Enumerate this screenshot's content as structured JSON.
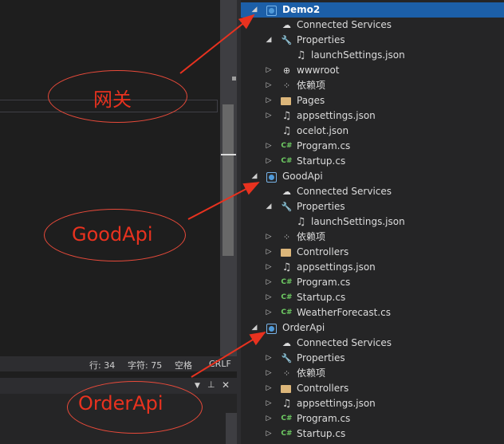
{
  "status_bar": {
    "line": "行: 34",
    "char": "字符: 75",
    "space": "空格",
    "crlf": "CRLF"
  },
  "panel": {
    "dropdown_icon": "▼",
    "pin_icon": "📌",
    "close_icon": "✕"
  },
  "explorer": {
    "rows": [
      {
        "label": "Demo2",
        "expander": "◢",
        "icon": "project-icon"
      },
      {
        "label": "Connected Services",
        "expander": "",
        "icon": "cloud-icon"
      },
      {
        "label": "Properties",
        "expander": "◢",
        "icon": "wrench-icon"
      },
      {
        "label": "launchSettings.json",
        "expander": "",
        "icon": "json-icon"
      },
      {
        "label": "wwwroot",
        "expander": "▷",
        "icon": "globe-icon"
      },
      {
        "label": "依赖项",
        "expander": "▷",
        "icon": "dependencies-icon"
      },
      {
        "label": "Pages",
        "expander": "▷",
        "icon": "folder-icon"
      },
      {
        "label": "appsettings.json",
        "expander": "▷",
        "icon": "json-icon"
      },
      {
        "label": "ocelot.json",
        "expander": "",
        "icon": "json-icon"
      },
      {
        "label": "Program.cs",
        "expander": "▷",
        "icon": "csharp-icon"
      },
      {
        "label": "Startup.cs",
        "expander": "▷",
        "icon": "csharp-icon"
      },
      {
        "label": "GoodApi",
        "expander": "◢",
        "icon": "project-icon"
      },
      {
        "label": "Connected Services",
        "expander": "",
        "icon": "cloud-icon"
      },
      {
        "label": "Properties",
        "expander": "◢",
        "icon": "wrench-icon"
      },
      {
        "label": "launchSettings.json",
        "expander": "",
        "icon": "json-icon"
      },
      {
        "label": "依赖项",
        "expander": "▷",
        "icon": "dependencies-icon"
      },
      {
        "label": "Controllers",
        "expander": "▷",
        "icon": "folder-icon"
      },
      {
        "label": "appsettings.json",
        "expander": "▷",
        "icon": "json-icon"
      },
      {
        "label": "Program.cs",
        "expander": "▷",
        "icon": "csharp-icon"
      },
      {
        "label": "Startup.cs",
        "expander": "▷",
        "icon": "csharp-icon"
      },
      {
        "label": "WeatherForecast.cs",
        "expander": "▷",
        "icon": "csharp-icon"
      },
      {
        "label": "OrderApi",
        "expander": "◢",
        "icon": "project-icon"
      },
      {
        "label": "Connected Services",
        "expander": "",
        "icon": "cloud-icon"
      },
      {
        "label": "Properties",
        "expander": "▷",
        "icon": "wrench-icon"
      },
      {
        "label": "依赖项",
        "expander": "▷",
        "icon": "dependencies-icon"
      },
      {
        "label": "Controllers",
        "expander": "▷",
        "icon": "folder-icon"
      },
      {
        "label": "appsettings.json",
        "expander": "▷",
        "icon": "json-icon"
      },
      {
        "label": "Program.cs",
        "expander": "▷",
        "icon": "csharp-icon"
      },
      {
        "label": "Startup.cs",
        "expander": "▷",
        "icon": "csharp-icon"
      }
    ]
  },
  "annotations": {
    "gateway": "网关",
    "goodapi": "GoodApi",
    "orderapi": "OrderApi",
    "color": "#e8321f"
  }
}
